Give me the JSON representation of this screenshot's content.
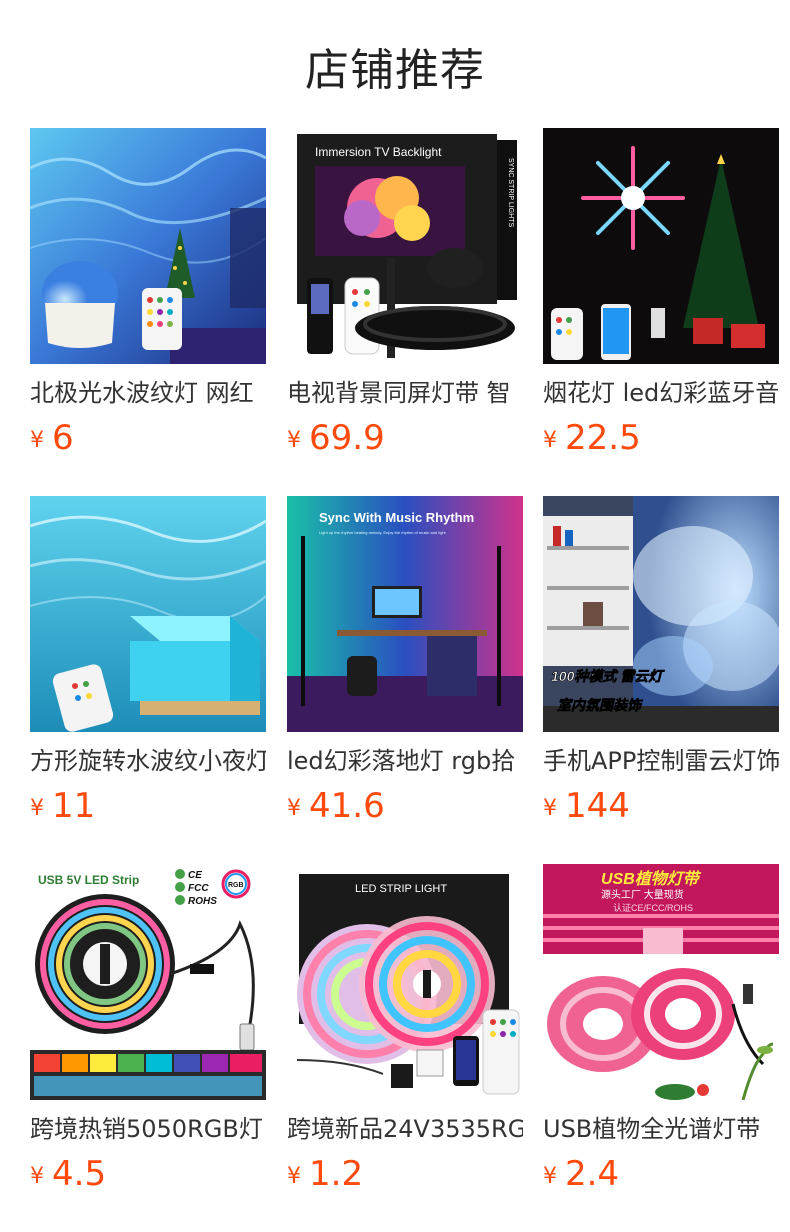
{
  "page": {
    "title": "店铺推荐"
  },
  "products": [
    {
      "name": "北极光水波纹灯 网红",
      "currency": "¥",
      "price": "6",
      "image_text": ""
    },
    {
      "name": "电视背景同屏灯带 智",
      "currency": "¥",
      "price": "69.9",
      "image_text": "Immersion TV Backlight",
      "image_text_2": "SYNC STRIP LIGHTS"
    },
    {
      "name": "烟花灯 led幻彩蓝牙音",
      "currency": "¥",
      "price": "22.5",
      "image_text": ""
    },
    {
      "name": "方形旋转水波纹小夜灯",
      "currency": "¥",
      "price": "11",
      "image_text": ""
    },
    {
      "name": "led幻彩落地灯 rgb拾",
      "currency": "¥",
      "price": "41.6",
      "image_text": "Sync With Music Rhythm",
      "image_text_2": "Light up the rhythm beating melody. Enjoy the rhythm of music and light"
    },
    {
      "name": "手机APP控制雷云灯饰",
      "currency": "¥",
      "price": "144",
      "image_text": "100种模式 雷云灯",
      "image_text_2": "室内氛围装饰"
    },
    {
      "name": "跨境热销5050RGB灯",
      "currency": "¥",
      "price": "4.5",
      "image_text": "USB 5V LED Strip",
      "image_text_2": "CE",
      "image_text_3": "FCC",
      "image_text_4": "ROHS",
      "image_text_5": "RGB"
    },
    {
      "name": "跨境新品24V3535RG",
      "currency": "¥",
      "price": "1.2",
      "image_text": "LED STRIP LIGHT"
    },
    {
      "name": "USB植物全光谱灯带",
      "currency": "¥",
      "price": "2.4",
      "image_text": "USB植物灯带",
      "image_text_2": "源头工厂 大量现货",
      "image_text_3": "认证CE/FCC/ROHS"
    }
  ]
}
